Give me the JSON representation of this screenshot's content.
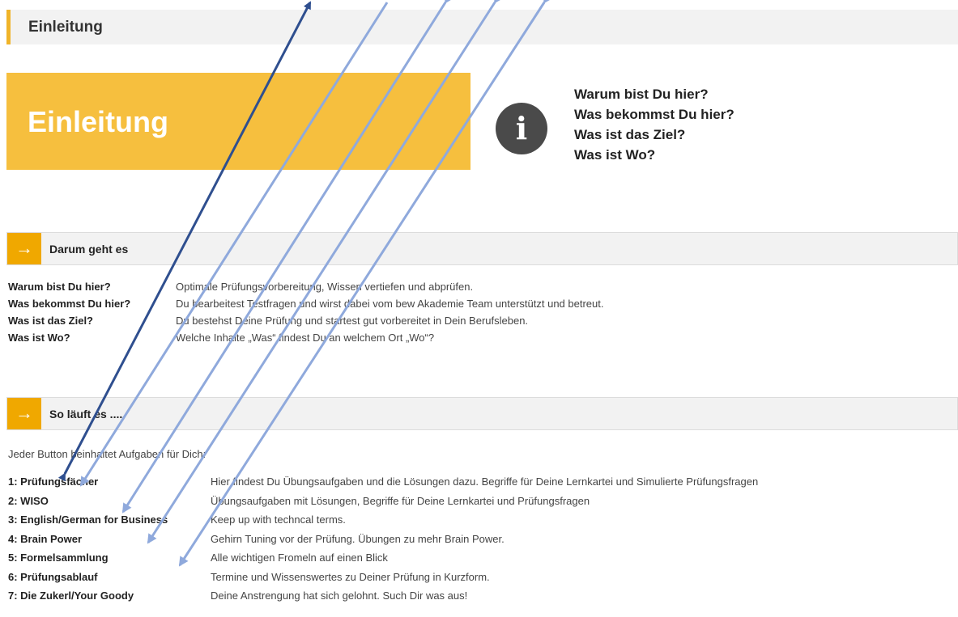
{
  "header": {
    "title": "Einleitung"
  },
  "banner": {
    "title": "Einleitung"
  },
  "info": {
    "icon": "info-icon",
    "glyph": "i",
    "questions": [
      "Warum bist Du hier?",
      "Was bekommst Du hier?",
      "Was ist das Ziel?",
      "Was ist Wo?"
    ]
  },
  "section1": {
    "arrow": "→",
    "title": "Darum geht es",
    "rows": [
      {
        "key": "Warum bist Du hier?",
        "value": "Optimale Prüfungsvorbereitung, Wissen vertiefen und abprüfen."
      },
      {
        "key": "Was bekommst Du hier?",
        "value": "Du bearbeitest Testfragen und wirst dabei vom bew Akademie Team unterstützt und betreut."
      },
      {
        "key": "Was ist das Ziel?",
        "value": "Du bestehst Deine Prüfung und startest gut vorbereitet in Dein Berufsleben."
      },
      {
        "key": "Was ist Wo?",
        "value": "Welche Inhalte „Was“ findest Du an welchem Ort „Wo“?"
      }
    ]
  },
  "section2": {
    "arrow": "→",
    "title": "So läuft es ....",
    "intro": "Jeder Button beinhaltet Aufgaben für Dich:",
    "rows": [
      {
        "key": "1: Prüfungsfächer",
        "value": "Hier findest Du Übungsaufgaben und die Lösungen dazu. Begriffe für Deine Lernkartei und Simulierte Prüfungsfragen"
      },
      {
        "key": "2: WISO",
        "value": "Übungsaufgaben mit Lösungen, Begriffe für Deine Lernkartei und Prüfungsfragen"
      },
      {
        "key": "3: English/German for Business",
        "value": "Keep up with techncal terms."
      },
      {
        "key": "4: Brain Power",
        "value": "Gehirn Tuning vor der Prüfung. Übungen zu mehr Brain Power."
      },
      {
        "key": "5: Formelsammlung",
        "value": "Alle wichtigen Fromeln auf einen Blick"
      },
      {
        "key": "6: Prüfungsablauf",
        "value": "Termine und Wissenswertes zu Deiner Prüfung in Kurzform."
      },
      {
        "key": "7: Die Zukerl/Your Goody",
        "value": "Deine Anstrengung hat sich gelohnt. Such Dir was aus!"
      }
    ]
  },
  "colors": {
    "accent": "#f0a800",
    "banner": "#f6bf3e",
    "arrow_dark": "#2f4f8f",
    "arrow_light": "#8fa9dc"
  }
}
